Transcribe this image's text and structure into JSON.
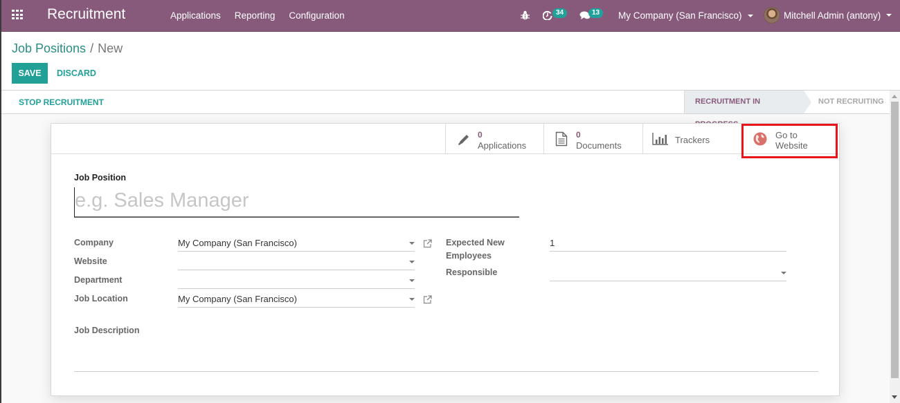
{
  "navbar": {
    "app_name": "Recruitment",
    "menu": [
      "Applications",
      "Reporting",
      "Configuration"
    ],
    "activity_count": "34",
    "message_count": "13",
    "company": "My Company (San Francisco)",
    "user": "Mitchell Admin (antony)",
    "icons": [
      "apps-grid-icon",
      "bug-icon",
      "clock-icon",
      "chat-icon",
      "caret-down-icon",
      "avatar"
    ],
    "color": "#875a7b"
  },
  "control_panel": {
    "breadcrumb": {
      "parent": "Job Positions",
      "current": "New"
    },
    "save_label": "SAVE",
    "discard_label": "DISCARD"
  },
  "statusbar": {
    "action_label": "STOP RECRUITMENT",
    "stages": [
      {
        "label": "RECRUITMENT IN PROGRESS",
        "active": true
      },
      {
        "label": "NOT RECRUITING",
        "active": false
      }
    ]
  },
  "button_box": {
    "applications": {
      "count": "0",
      "label": "Applications",
      "icon": "pencil-icon"
    },
    "documents": {
      "count": "0",
      "label": "Documents",
      "icon": "document-icon"
    },
    "trackers": {
      "label": "Trackers",
      "icon": "bar-chart-icon"
    },
    "website": {
      "line1": "Go to",
      "line2": "Website",
      "icon": "globe-icon"
    }
  },
  "form": {
    "job_position_label": "Job Position",
    "job_position_placeholder": "e.g. Sales Manager",
    "job_position_value": "",
    "left_fields": [
      {
        "label": "Company",
        "value": "My Company (San Francisco)",
        "external_link": true
      },
      {
        "label": "Website",
        "value": "",
        "external_link": false
      },
      {
        "label": "Department",
        "value": "",
        "external_link": false
      },
      {
        "label": "Job Location",
        "value": "My Company (San Francisco)",
        "external_link": true
      }
    ],
    "right_fields": [
      {
        "label": "Expected New Employees",
        "value": "1"
      },
      {
        "label": "Responsible",
        "value": ""
      }
    ],
    "description_label": "Job Description",
    "description_value": ""
  },
  "colors": {
    "brand": "#875a7b",
    "primary": "#21a098",
    "highlight": "#e8141a",
    "globe": "#d9706a"
  }
}
